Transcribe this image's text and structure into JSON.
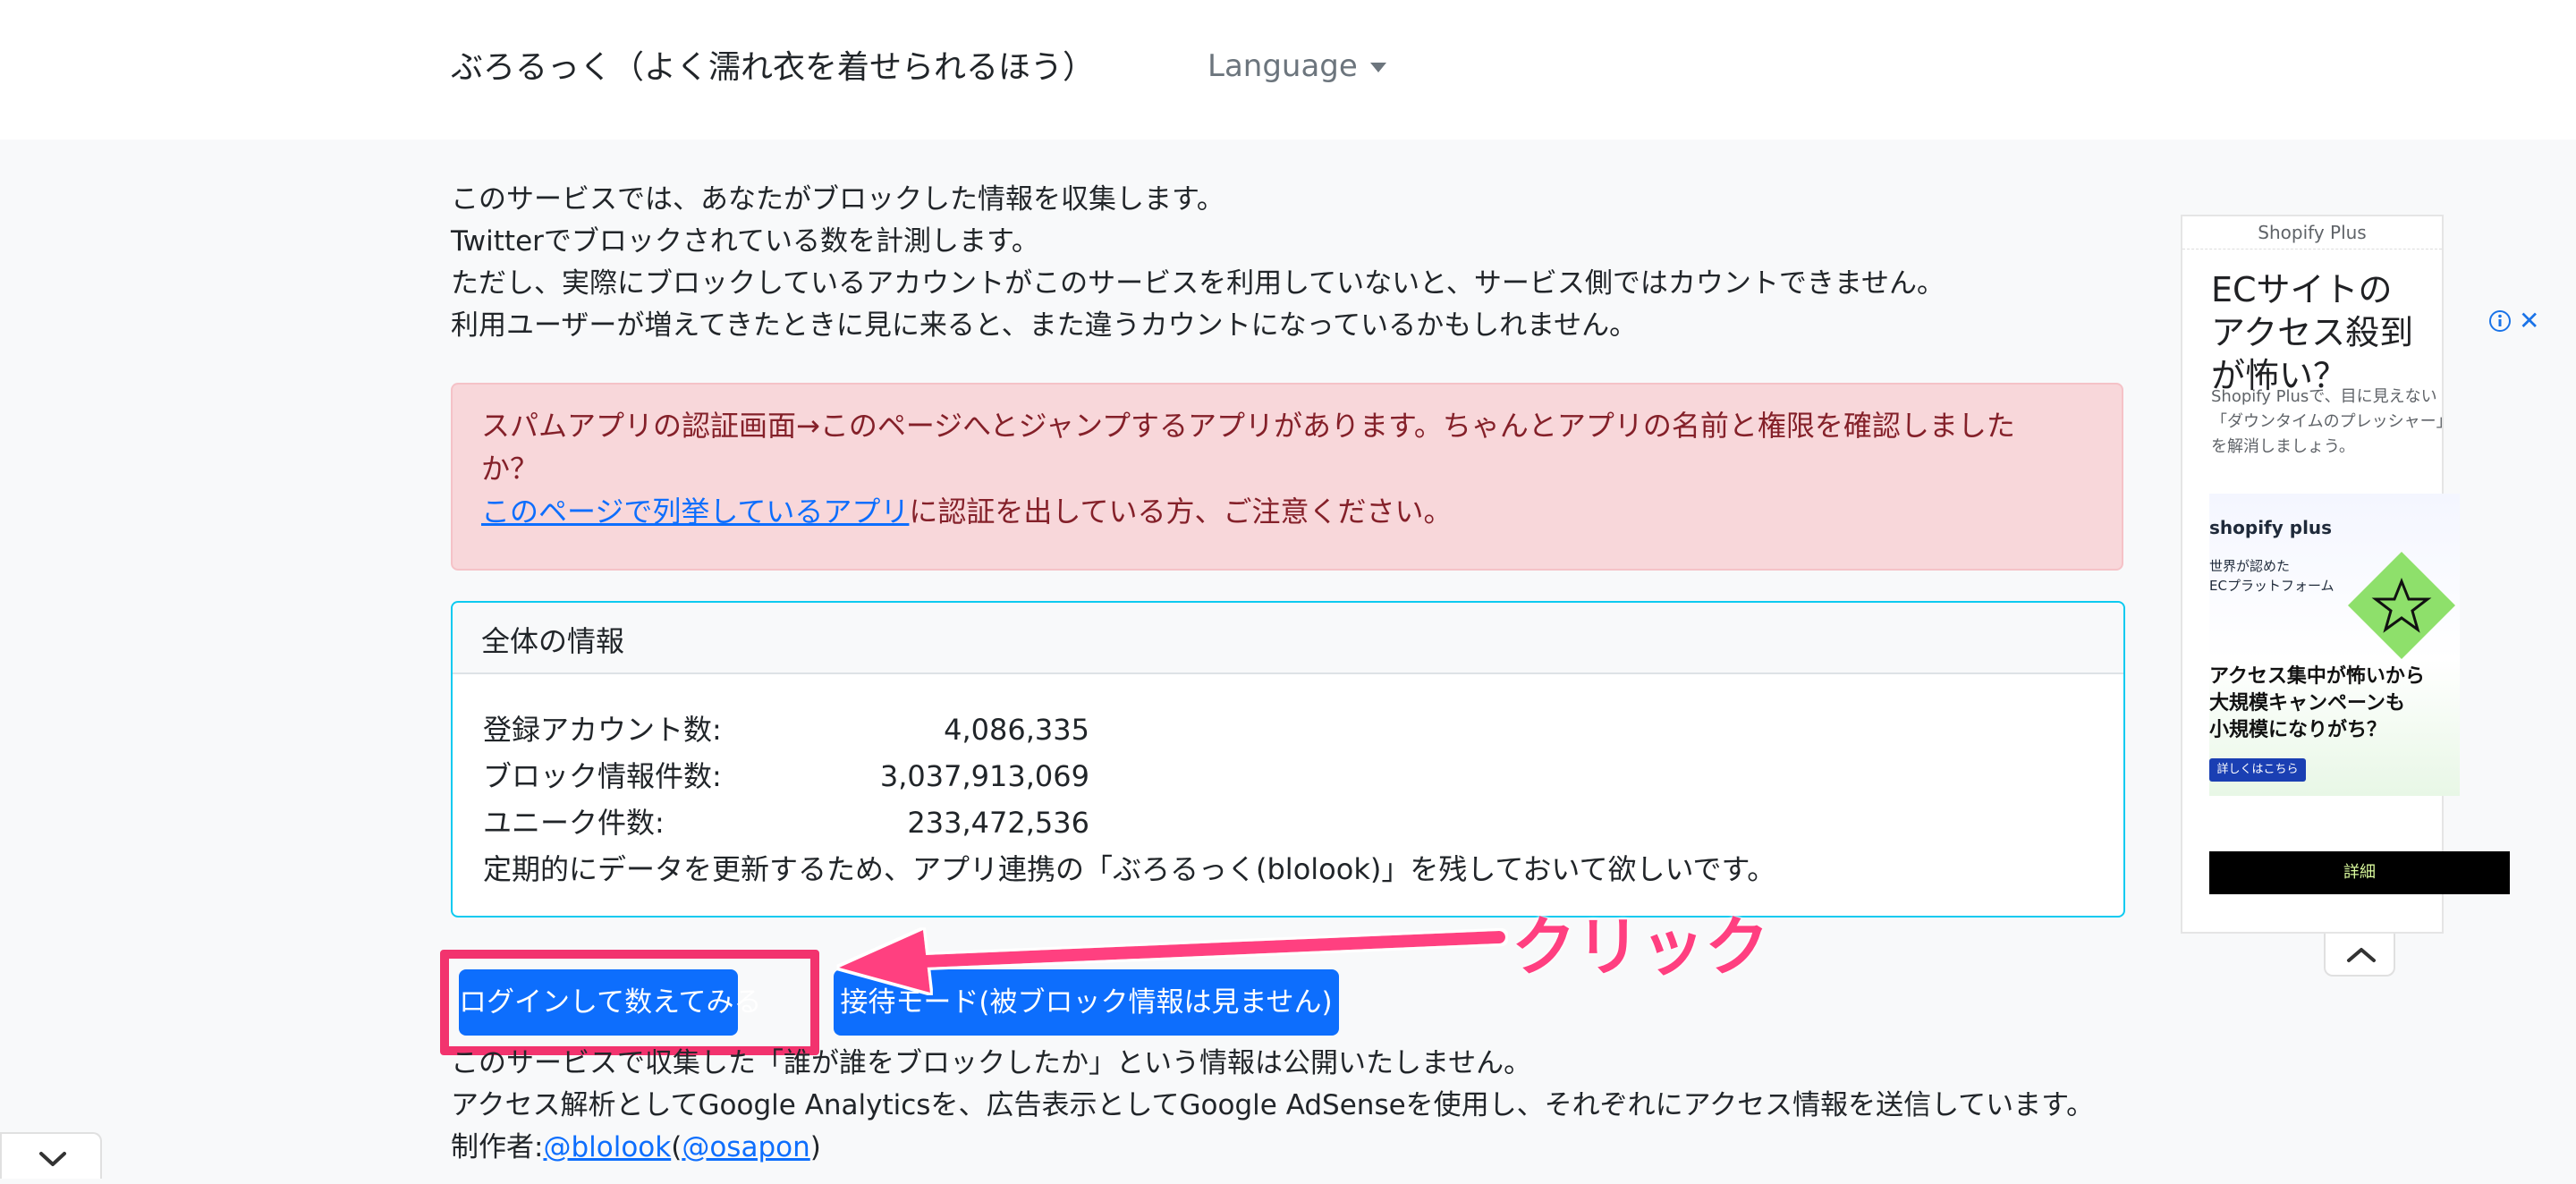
{
  "header": {
    "brand": "ぶろるっく（よく濡れ衣を着せられるほう）",
    "language_label": "Language"
  },
  "intro": {
    "lines": [
      "このサービスでは、あなたがブロックした情報を収集します。",
      "Twitterでブロックされている数を計測します。",
      "ただし、実際にブロックしているアカウントがこのサービスを利用していないと、サービス側ではカウントできません。",
      "利用ユーザーが増えてきたときに見に来ると、また違うカウントになっているかもしれません。"
    ]
  },
  "alert": {
    "line1": "スパムアプリの認証画面→このページへとジャンプするアプリがあります。ちゃんとアプリの名前と権限を確認しました",
    "line2": "か？",
    "link": "このページで列挙しているアプリ",
    "line3_rest": "に認証を出している方、ご注意ください。"
  },
  "stats_card": {
    "header": "全体の情報",
    "rows": [
      {
        "label": "登録アカウント数:",
        "value": "4,086,335"
      },
      {
        "label": "ブロック情報件数:",
        "value": "3,037,913,069"
      },
      {
        "label": "ユニーク件数:",
        "value": "233,472,536"
      }
    ],
    "note": "定期的にデータを更新するため、アプリ連携の「ぶろるっく(blolook)」を残しておいて欲しいです。"
  },
  "buttons": {
    "login": "ログインして数えてみる",
    "guest": "接待モード(被ブロック情報は見ません)"
  },
  "annotation": {
    "text": "クリック",
    "color": "#f2336e"
  },
  "footer": {
    "line1": "このサービスで収集した「誰が誰をブロックしたか」という情報は公開いたしません。",
    "line2": "アクセス解析としてGoogle Analyticsを、広告表示としてGoogle AdSenseを使用し、それぞれにアクセス情報を送信しています。",
    "author_label": "制作者:",
    "author_link1": "@blolook",
    "open_paren": "(",
    "author_link2": "@osapon",
    "close_paren": ")"
  },
  "ad": {
    "label": "Shopify Plus",
    "title": "ECサイトのアクセス殺到が怖い？",
    "description": "Shopify Plusで、目に見えない「ダウンタイムのプレッシャー」を解消しましょう。",
    "banner_logo": "shopify plus",
    "banner_sub_line1": "世界が認めた",
    "banner_sub_line2": "ECプラットフォーム",
    "banner_headline_line1": "アクセス集中が怖いから",
    "banner_headline_line2": "大規模キャンペーンも",
    "banner_headline_line3": "小規模になりがち？",
    "banner_button": "詳しくはこちら",
    "cta": "詳細"
  },
  "colors": {
    "primary": "#0d6efd",
    "alert_bg": "#f8d7da",
    "alert_text": "#842029",
    "card_border": "#0dcaf0",
    "annotation": "#ff3f80"
  }
}
